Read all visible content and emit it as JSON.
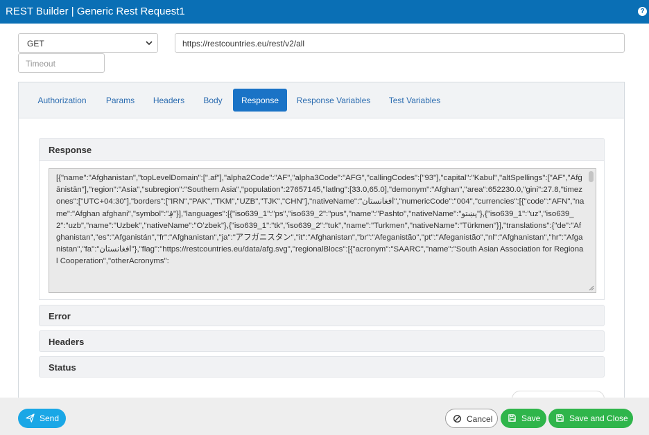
{
  "window": {
    "title": "REST Builder | Generic Rest Request1",
    "help_icon": "question-circle-icon",
    "help_glyph": "?"
  },
  "request": {
    "method": "GET",
    "url": "https://restcountries.eu/rest/v2/all",
    "timeout_placeholder": "Timeout"
  },
  "tabs": [
    {
      "label": "Authorization",
      "active": false
    },
    {
      "label": "Params",
      "active": false
    },
    {
      "label": "Headers",
      "active": false
    },
    {
      "label": "Body",
      "active": false
    },
    {
      "label": "Response",
      "active": true
    },
    {
      "label": "Response Variables",
      "active": false
    },
    {
      "label": "Test Variables",
      "active": false
    }
  ],
  "sections": {
    "response": "Response",
    "error": "Error",
    "headers": "Headers",
    "status": "Status"
  },
  "response_body": "[{\"name\":\"Afghanistan\",\"topLevelDomain\":[\".af\"],\"alpha2Code\":\"AF\",\"alpha3Code\":\"AFG\",\"callingCodes\":[\"93\"],\"capital\":\"Kabul\",\"altSpellings\":[\"AF\",\"Afġānistān\"],\"region\":\"Asia\",\"subregion\":\"Southern Asia\",\"population\":27657145,\"latlng\":[33.0,65.0],\"demonym\":\"Afghan\",\"area\":652230.0,\"gini\":27.8,\"timezones\":[\"UTC+04:30\"],\"borders\":[\"IRN\",\"PAK\",\"TKM\",\"UZB\",\"TJK\",\"CHN\"],\"nativeName\":\"افغانستان\",\"numericCode\":\"004\",\"currencies\":[{\"code\":\"AFN\",\"name\":\"Afghan afghani\",\"symbol\":\"؋\"}],\"languages\":[{\"iso639_1\":\"ps\",\"iso639_2\":\"pus\",\"name\":\"Pashto\",\"nativeName\":\"پښتو\"},{\"iso639_1\":\"uz\",\"iso639_2\":\"uzb\",\"name\":\"Uzbek\",\"nativeName\":\"Oʻzbek\"},{\"iso639_1\":\"tk\",\"iso639_2\":\"tuk\",\"name\":\"Turkmen\",\"nativeName\":\"Türkmen\"}],\"translations\":{\"de\":\"Afghanistan\",\"es\":\"Afganistán\",\"fr\":\"Afghanistan\",\"ja\":\"アフガニスタン\",\"it\":\"Afghanistan\",\"br\":\"Afeganistão\",\"pt\":\"Afeganistão\",\"nl\":\"Afghanistan\",\"hr\":\"Afganistan\",\"fa\":\"افغانستان\"},\"flag\":\"https://restcountries.eu/data/afg.svg\",\"regionalBlocs\":[{\"acronym\":\"SAARC\",\"name\":\"South Asian Association for Regional Cooperation\",\"otherAcronyms\":",
  "footer": {
    "send": "Send",
    "cancel": "Cancel",
    "save": "Save",
    "save_close": "Save and Close"
  },
  "icons": {
    "send": "paper-plane-icon",
    "cancel": "ban-icon",
    "save": "floppy-disk-icon",
    "method_dropdown": "chevron-down-icon"
  },
  "colors": {
    "titlebar": "#0a6fb5",
    "tab_active": "#1a73c6",
    "tab_text": "#2b6cb0",
    "send": "#1aa7e6",
    "save": "#2fb54b"
  }
}
